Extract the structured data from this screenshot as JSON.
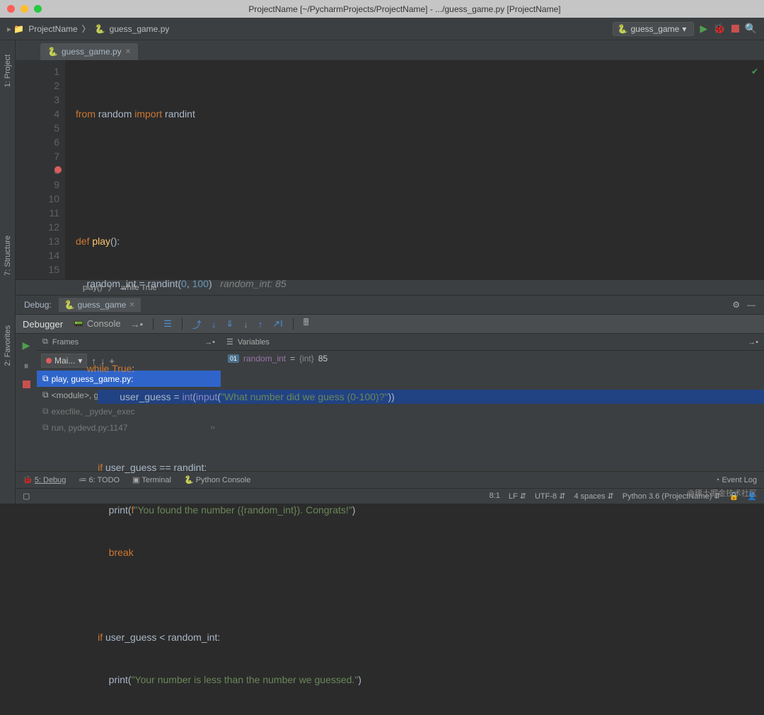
{
  "titlebar": "ProjectName [~/PycharmProjects/ProjectName] - .../guess_game.py [ProjectName]",
  "breadcrumb": {
    "project": "ProjectName",
    "file": "guess_game.py"
  },
  "run_config": "guess_game",
  "tab": {
    "name": "guess_game.py"
  },
  "left_rail": {
    "project": "1: Project",
    "structure": "7: Structure",
    "favorites": "2: Favorites"
  },
  "code": {
    "lines": [
      1,
      2,
      3,
      4,
      5,
      6,
      7,
      8,
      9,
      10,
      11,
      12,
      13,
      14,
      15
    ],
    "l1_kw1": "from",
    "l1_mod": "random",
    "l1_kw2": "import",
    "l1_name": "randint",
    "l4_kw": "def",
    "l4_fn": "play",
    "l4_paren": "():",
    "l5_txt": "    random_int = randint(",
    "l5_n1": "0",
    "l5_c": ", ",
    "l5_n2": "100",
    "l5_end": ")",
    "l5_cmt": "   random_int: 85",
    "l7_kw": "while",
    "l7_true": "True",
    "l7_end": ":",
    "l8_txt": "        user_guess = ",
    "l8_int": "int",
    "l8_p1": "(",
    "l8_inp": "input",
    "l8_p2": "(",
    "l8_str": "\"What number did we guess (0-100)?\"",
    "l8_end": "))",
    "l10_txt": "        ",
    "l10_if": "if",
    "l10_rest": " user_guess == randint:",
    "l11_txt": "            print(",
    "l11_f": "f",
    "l11_str": "\"You found the number ({random_int}). Congrats!\"",
    "l11_end": ")",
    "l12_txt": "            ",
    "l12_kw": "break",
    "l14_txt": "        ",
    "l14_if": "if",
    "l14_rest": " user_guess < random_int:",
    "l15_txt": "            print(",
    "l15_str": "\"Your number is less than the number we guessed.\"",
    "l15_end": ")"
  },
  "crumbs": {
    "a": "play()",
    "b": "while True"
  },
  "debug": {
    "label": "Debug:",
    "tab": "guess_game",
    "debugger": "Debugger",
    "console": "Console",
    "frames_label": "Frames",
    "vars_label": "Variables",
    "thread": "Mai...",
    "frame1": "play, guess_game.py:",
    "frame2": "<module>, guess_gan",
    "frame3": "execfile, _pydev_exec",
    "frame4": "run, pydevd.py:1147",
    "var_name": "random_int",
    "var_eq": " = ",
    "var_type": "{int} ",
    "var_val": "85"
  },
  "tools": {
    "debug": "5: Debug",
    "todo": "6: TODO",
    "terminal": "Terminal",
    "pyconsole": "Python Console",
    "eventlog": "Event Log"
  },
  "status": {
    "pos": "8:1",
    "lf": "LF",
    "enc": "UTF-8",
    "indent": "4 spaces",
    "py": "Python 3.6 (ProjectName)"
  },
  "watermark": "@稀土掘金技术社区"
}
